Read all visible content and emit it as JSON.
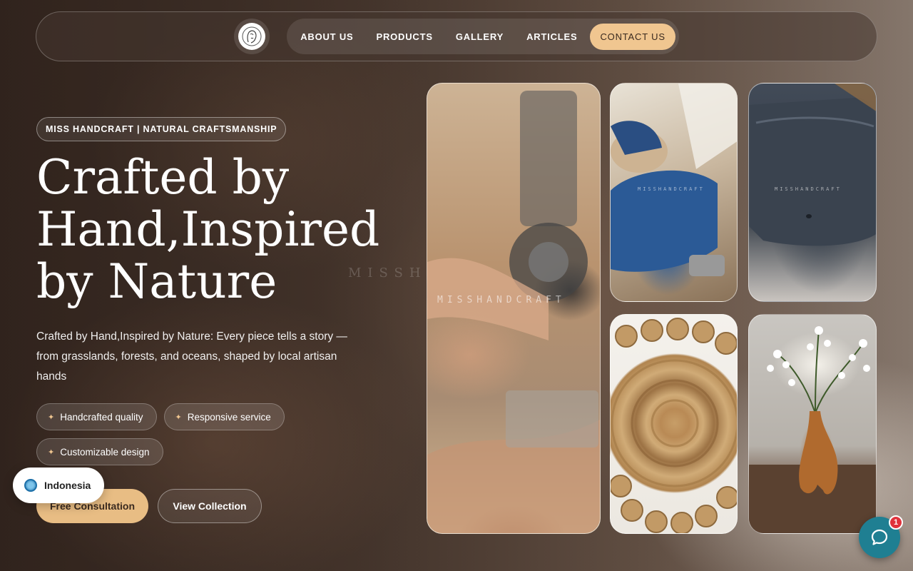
{
  "nav": {
    "logo_icon": "woman-portrait-logo-icon",
    "items": [
      {
        "label": "ABOUT US"
      },
      {
        "label": "PRODUCTS"
      },
      {
        "label": "GALLERY"
      },
      {
        "label": "ARTICLES"
      },
      {
        "label": "CONTACT US",
        "active": true
      }
    ]
  },
  "hero": {
    "tagline": "MISS HANDCRAFT | NATURAL CRAFTSMANSHIP",
    "headline_lines": [
      "Crafted by",
      "Hand,Inspired",
      "by Nature"
    ],
    "description": "Crafted by Hand,Inspired by Nature: Every piece tells a story — from grasslands, forests, and oceans, shaped by local artisan hands",
    "features": [
      {
        "icon": "sparkle-icon",
        "label": "Handcrafted quality"
      },
      {
        "icon": "sparkle-icon",
        "label": "Responsive service"
      },
      {
        "icon": "sparkle-icon",
        "label": "Customizable design"
      }
    ],
    "cta_primary": "Free Consultation",
    "cta_secondary": "View Collection"
  },
  "background_watermark": "MISSH",
  "gallery": {
    "watermark": "MISSHANDCRAFT",
    "images": [
      {
        "subject": "sewing-machine-stitching-jute"
      },
      {
        "subject": "craftsman-grinding"
      },
      {
        "subject": "stone-bathtub"
      },
      {
        "subject": "round-jute-rug"
      },
      {
        "subject": "wooden-vase-with-flowers"
      }
    ]
  },
  "language": {
    "label": "Indonesia",
    "icon": "globe-icon"
  },
  "chat": {
    "icon": "chat-bubble-icon",
    "badge": "1"
  },
  "colors": {
    "accent": "#f0c690",
    "cta": "#e8bd84",
    "chat": "#1f7f92",
    "badge": "#e0323b"
  }
}
